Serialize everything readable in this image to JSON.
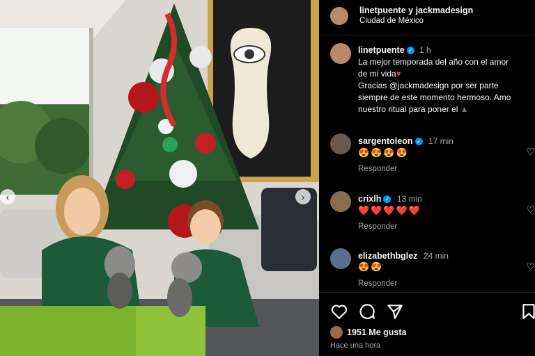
{
  "post": {
    "author": "linetpuente",
    "header_title": "linetpuente y jackmadesign",
    "location": "Ciudad de México",
    "time": "1 h",
    "caption_line1": "La mejor temporada del año con el amor",
    "caption_line2": "de mi vida",
    "caption_line3": "Gracias @jackmadesign por ser parte",
    "caption_line4": "siempre de este momento hermoso. Amo",
    "caption_line5": "nuestro ritual para poner el"
  },
  "comments": [
    {
      "user": "sargentoleon",
      "time": "17 min",
      "text": "😍😍😍😍",
      "reply": "Responder",
      "verified": true
    },
    {
      "user": "crixlh",
      "time": "13 min",
      "text": "❤️❤️❤️❤️❤️",
      "reply": "Responder",
      "verified": true
    },
    {
      "user": "elizabethbglez",
      "time": "24 min",
      "text": "😍😍",
      "reply": "Responder",
      "verified": false
    }
  ],
  "footer": {
    "likes": "1951 Me gusta",
    "posted": "Hace una hora"
  },
  "colors": {
    "accent": "#0095f6",
    "heart": "#ff3040",
    "bg": "#000000"
  },
  "icons": [
    "heart-icon",
    "comment-icon",
    "share-icon",
    "bookmark-icon",
    "verified-icon",
    "chevron-left-icon",
    "chevron-right-icon"
  ]
}
